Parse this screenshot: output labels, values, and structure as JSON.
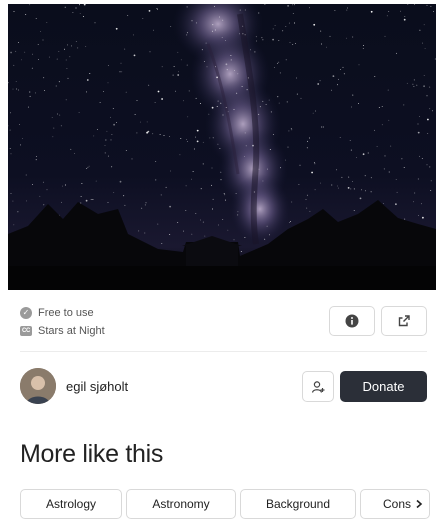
{
  "photo": {
    "subject": "milky-way-night-sky",
    "alt_icon": "photo-image"
  },
  "license": {
    "label": "Free to use",
    "icon": "check-circle-icon"
  },
  "collection": {
    "label": "Stars at Night",
    "icon": "cc-icon",
    "badge_text": "CC"
  },
  "actions": {
    "info_icon": "info-icon",
    "share_icon": "external-link-icon"
  },
  "author": {
    "name": "egil sjøholt",
    "follow_icon": "add-user-icon",
    "donate_label": "Donate"
  },
  "more": {
    "title": "More like this",
    "tags": [
      "Astrology",
      "Astronomy",
      "Background",
      "Cons"
    ],
    "next_icon": "chevron-right-icon"
  },
  "colors": {
    "primary_button": "#2b2f38",
    "border": "#d9d9d9",
    "muted_text": "#555555"
  }
}
